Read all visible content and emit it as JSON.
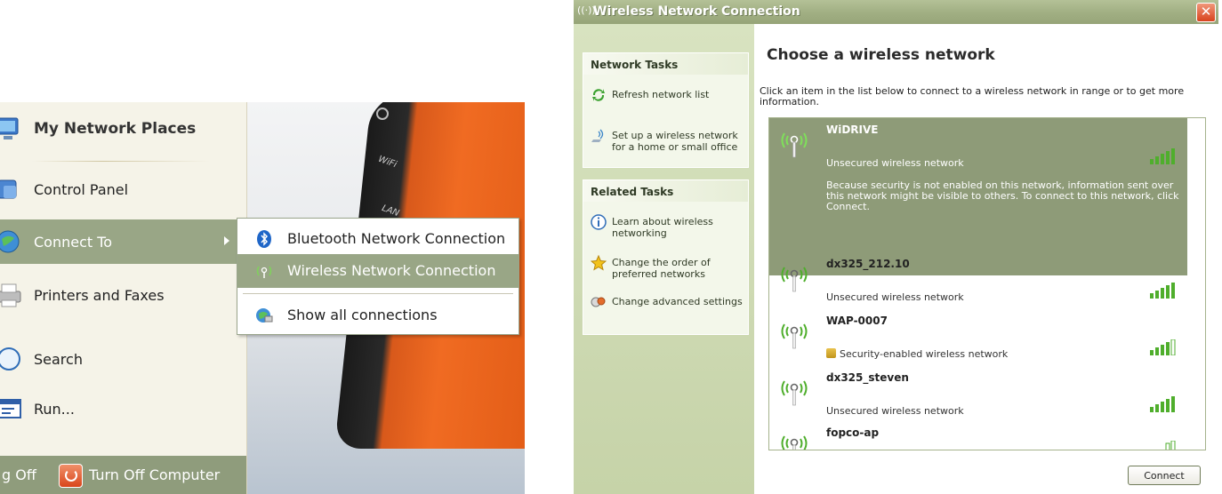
{
  "start_menu": {
    "items": [
      {
        "label": "My Network Places"
      },
      {
        "label": "Control Panel"
      },
      {
        "label": "Connect To"
      },
      {
        "label": "Printers and Faxes"
      },
      {
        "label": "Search"
      },
      {
        "label": "Run..."
      }
    ],
    "taskbar": {
      "log_off": "g Off",
      "turn_off": "Turn Off Computer"
    },
    "device_labels": [
      "WiFi",
      "LAN"
    ]
  },
  "submenu": {
    "items": [
      {
        "label": "Bluetooth Network Connection",
        "icon": "bluetooth-icon"
      },
      {
        "label": "Wireless Network Connection",
        "icon": "wireless-icon"
      },
      {
        "label": "Show all connections",
        "icon": "network-globe-icon"
      }
    ]
  },
  "dialog": {
    "title": "Wireless Network Connection",
    "close_glyph": "✕",
    "sidebar": {
      "network_tasks": {
        "header": "Network Tasks",
        "links": [
          "Refresh network list",
          "Set up a wireless network for a home or small office"
        ]
      },
      "related_tasks": {
        "header": "Related Tasks",
        "links": [
          "Learn about wireless networking",
          "Change the order of preferred networks",
          "Change advanced settings"
        ]
      }
    },
    "main": {
      "title": "Choose a wireless network",
      "description": "Click an item in the list below to connect to a wireless network in range or to get more information.",
      "networks": [
        {
          "ssid": "WiDRIVE",
          "status": "Unsecured wireless network",
          "warning": "Because security is not enabled on this network, information sent over this network might be visible to others. To connect to this network, click Connect.",
          "signal_bars": 5,
          "selected": true
        },
        {
          "ssid": "dx325_212.10",
          "status": "Unsecured wireless network",
          "signal_bars": 5
        },
        {
          "ssid": "WAP-0007",
          "status": "Security-enabled wireless network",
          "signal_bars": 4,
          "secured": true
        },
        {
          "ssid": "dx325_steven",
          "status": "Unsecured wireless network",
          "signal_bars": 5
        },
        {
          "ssid": "fopco-ap",
          "status": "",
          "signal_bars": 2
        }
      ],
      "connect_label": "Connect"
    },
    "colors": {
      "selected": "#8e9b78",
      "titlebar": "#a2b084",
      "signal": "#4fae2c"
    }
  }
}
